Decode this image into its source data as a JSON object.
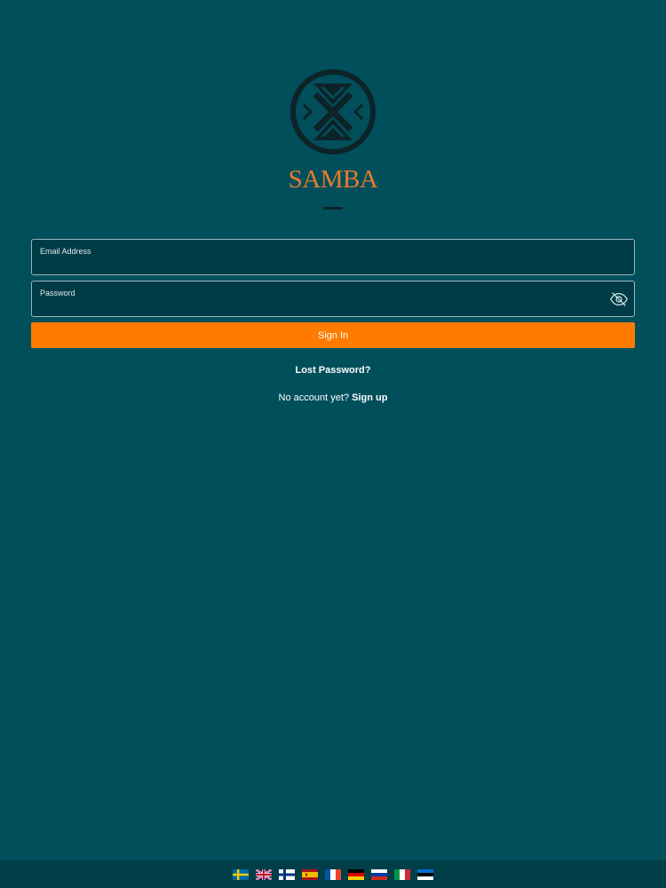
{
  "brand": {
    "name": "SAMBA",
    "logo_icon": "samba-x-circle-logo",
    "accent_color": "#e87b2a"
  },
  "login": {
    "email_label": "Email Address",
    "email_value": "",
    "password_label": "Password",
    "password_value": "",
    "password_toggle_icon": "eye-slash-icon",
    "signin_label": "Sign In",
    "signin_color": "#ff7b00",
    "lost_password": "Lost Password?",
    "no_account": "No account yet?",
    "signup": "Sign up"
  },
  "languages": [
    {
      "code": "sv",
      "icon": "flag-sweden"
    },
    {
      "code": "en",
      "icon": "flag-uk"
    },
    {
      "code": "fi",
      "icon": "flag-finland"
    },
    {
      "code": "es",
      "icon": "flag-spain"
    },
    {
      "code": "fr",
      "icon": "flag-france"
    },
    {
      "code": "de",
      "icon": "flag-germany"
    },
    {
      "code": "ru",
      "icon": "flag-russia"
    },
    {
      "code": "it",
      "icon": "flag-italy"
    },
    {
      "code": "et",
      "icon": "flag-estonia"
    }
  ],
  "colors": {
    "background": "#004f5b",
    "field_background": "#003c47",
    "footer_background": "#003e48"
  }
}
